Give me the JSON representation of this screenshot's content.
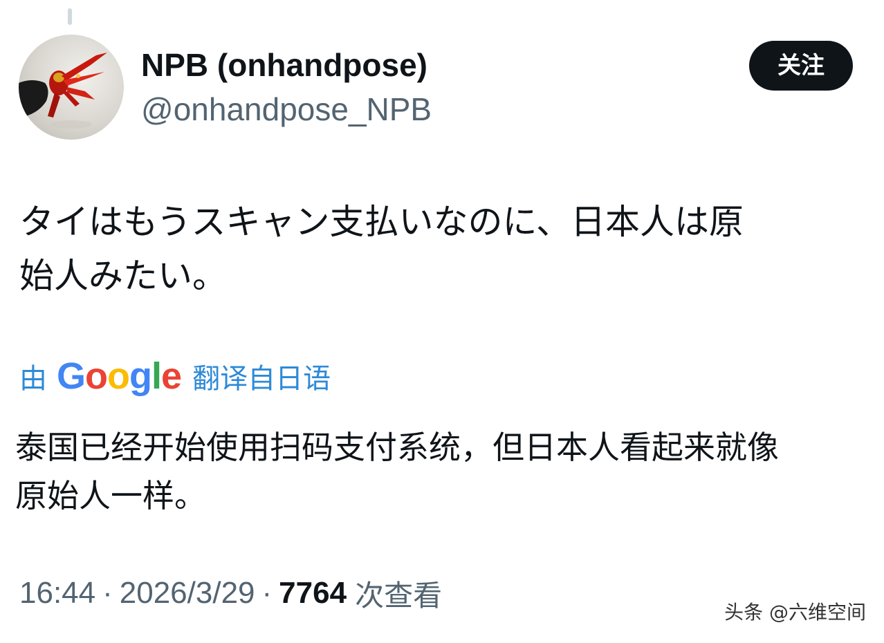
{
  "author": {
    "display_name": "NPB (onhandpose)",
    "handle": "@onhandpose_NPB"
  },
  "follow_button": {
    "label": "关注"
  },
  "tweet": {
    "text_line1": "タイはもうスキャン支払いなのに、日本人は原",
    "text_line2": "始人みたい。"
  },
  "translation": {
    "prefix": "由",
    "provider": "Google",
    "suffix": "翻译自日语",
    "text_line1": "泰国已经开始使用扫码支付系统，但日本人看起来就像",
    "text_line2": "原始人一样。"
  },
  "meta": {
    "time": "16:44",
    "date": "2026/3/29",
    "separator": "·",
    "views_count": "7764",
    "views_label": "次查看"
  },
  "watermark": {
    "text": "头条 @六维空间"
  },
  "colors": {
    "text_primary": "#0f1419",
    "text_secondary": "#536471",
    "link_blue": "#2d8ad8",
    "follow_bg": "#0f1419"
  }
}
